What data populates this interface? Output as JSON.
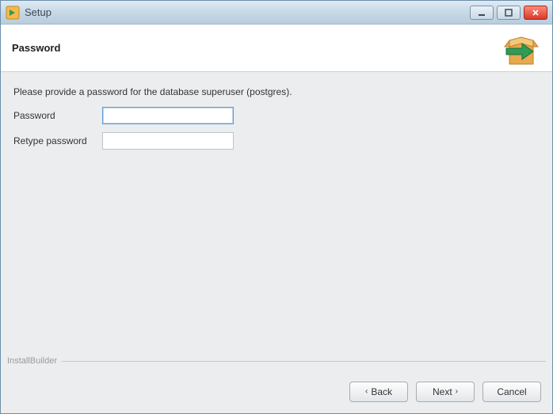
{
  "window": {
    "title": "Setup"
  },
  "header": {
    "title": "Password"
  },
  "content": {
    "instruction": "Please provide a password for the database superuser (postgres).",
    "password_label": "Password",
    "retype_label": "Retype password",
    "password_value": "",
    "retype_value": ""
  },
  "branding": "InstallBuilder",
  "footer": {
    "back_glyph": "‹",
    "back_label": "Back",
    "next_label": "Next",
    "next_glyph": "›",
    "cancel_label": "Cancel"
  }
}
